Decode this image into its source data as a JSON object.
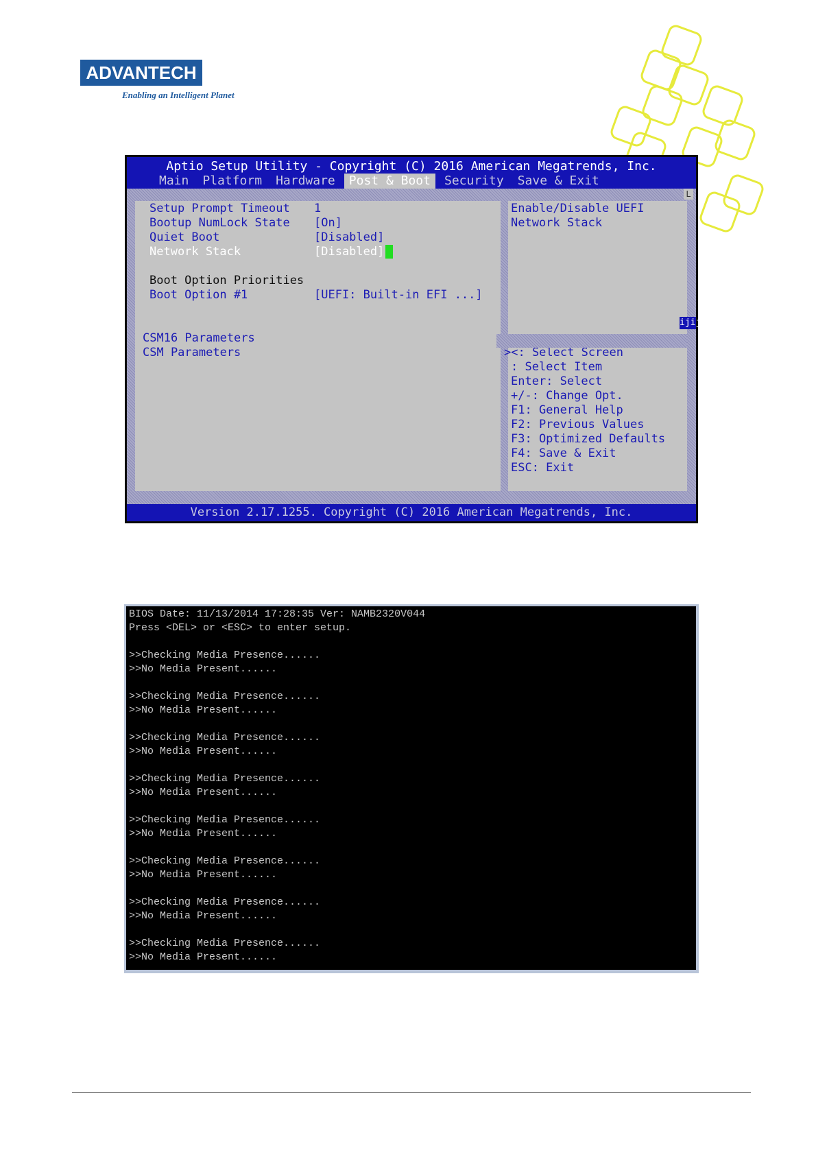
{
  "logo": {
    "brand": "ADVANTECH",
    "tagline": "Enabling an Intelligent Planet"
  },
  "colors": {
    "logo_blue": "#1f5a9e",
    "deco_yellow": "#e6ea3c",
    "bios_blue": "#1414b4",
    "bios_gray": "#c4c4c4",
    "cursor_green": "#22dd22"
  },
  "bios": {
    "title": "Aptio Setup Utility - Copyright (C) 2016 American Megatrends, Inc.",
    "tabs": [
      {
        "label": "Main"
      },
      {
        "label": "Platform"
      },
      {
        "label": "Hardware"
      },
      {
        "label": "Post & Boot",
        "active": true
      },
      {
        "label": "Security"
      },
      {
        "label": "Save & Exit"
      }
    ],
    "settings": [
      {
        "label": "Setup Prompt Timeout",
        "value": "1"
      },
      {
        "label": "Bootup NumLock State",
        "value": "[On]"
      },
      {
        "label": "Quiet Boot",
        "value": "[Disabled]"
      },
      {
        "label": "Network Stack",
        "value": "[Disabled]",
        "selected": true
      }
    ],
    "boot_priorities": {
      "heading": "Boot Option Priorities",
      "label": "Boot Option #1",
      "value": "[UEFI: Built-in EFI ...]"
    },
    "submenus": [
      "CSM16 Parameters",
      "CSM Parameters"
    ],
    "help": {
      "line1": "Enable/Disable UEFI",
      "line2": "Network Stack"
    },
    "keys": [
      "><: Select Screen",
      ": Select Item",
      "Enter: Select",
      "+/-: Change Opt.",
      "F1: General Help",
      "F2: Previous Values",
      "F3: Optimized Defaults",
      "F4: Save & Exit",
      "ESC: Exit"
    ],
    "scroll_top_glyph": "L",
    "scroll_cap_glyph": "ijij",
    "footer": "Version 2.17.1255. Copyright (C) 2016 American Megatrends, Inc."
  },
  "post": {
    "bios_date": "BIOS Date: 11/13/2014 17:28:35 Ver: NAMB2320V044",
    "prompt": "Press <DEL> or <ESC> to enter setup.",
    "blocks": [
      {
        "checking": ">>Checking Media Presence......",
        "result": ">>No Media Present......"
      },
      {
        "checking": ">>Checking Media Presence......",
        "result": ">>No Media Present......"
      },
      {
        "checking": ">>Checking Media Presence......",
        "result": ">>No Media Present......"
      },
      {
        "checking": ">>Checking Media Presence......",
        "result": ">>No Media Present......"
      },
      {
        "checking": ">>Checking Media Presence......",
        "result": ">>No Media Present......"
      },
      {
        "checking": ">>Checking Media Presence......",
        "result": ">>No Media Present......"
      },
      {
        "checking": ">>Checking Media Presence......",
        "result": ">>No Media Present......"
      },
      {
        "checking": ">>Checking Media Presence......",
        "result": ">>No Media Present......"
      }
    ]
  }
}
